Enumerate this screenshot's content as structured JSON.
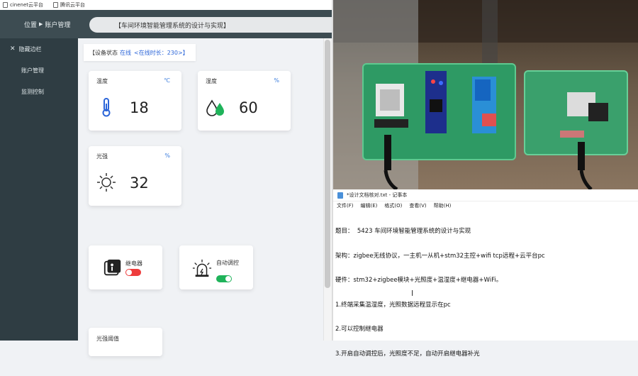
{
  "bookmarks": [
    "cinenet云平台",
    "腾讯云平台"
  ],
  "sidebar": {
    "header": "位置",
    "header_arrow": "▶",
    "header_page": "账户管理",
    "items": [
      {
        "label": "隐藏边栏"
      },
      {
        "label": "账户管理"
      },
      {
        "label": "监测控制"
      }
    ]
  },
  "breadcrumb": "【车间环境智能管理系统的设计与实现】",
  "status": {
    "prefix": "【设备状态",
    "online": "在线",
    "duration": "<在线时长：230>】"
  },
  "cards": [
    {
      "title": "温度",
      "unit": "℃",
      "value": "18",
      "icon": "thermometer-icon"
    },
    {
      "title": "湿度",
      "unit": "%",
      "value": "60",
      "icon": "water-drop-icon"
    },
    {
      "title": "光强",
      "unit": "%",
      "value": "32",
      "icon": "sun-icon"
    }
  ],
  "controls": {
    "relay": {
      "label": "继电器",
      "state": "off",
      "icon": "relay-icon"
    },
    "auto": {
      "label": "自动调控",
      "state": "on",
      "icon": "alarm-light-icon"
    },
    "threshold_label": "光强阈值"
  },
  "notepad": {
    "title": "*设计文档核对.txt - 记事本",
    "menu": [
      "文件(F)",
      "编辑(E)",
      "格式(O)",
      "查看(V)",
      "帮助(H)"
    ],
    "lines": [
      "题目：  5423 车间环境智能管理系统的设计与实现",
      "架构：zigbee无线协议，一主机一从机+stm32主控+wifi tcp远程+云平台pc",
      "硬件：stm32+zigbee模块+光照度+温湿度+继电器+WiFi。",
      "1.终端采集温湿度，光照数据远程显示在pc",
      "2.可以控制继电器",
      "3.开启自动调控后，光照度不足，自动开启继电器补光"
    ]
  },
  "colors": {
    "sidebar": "#2f3d43",
    "accent_blue": "#3b7ddd",
    "toggle_on": "#1fb35a",
    "toggle_off": "#ee3c3c"
  }
}
